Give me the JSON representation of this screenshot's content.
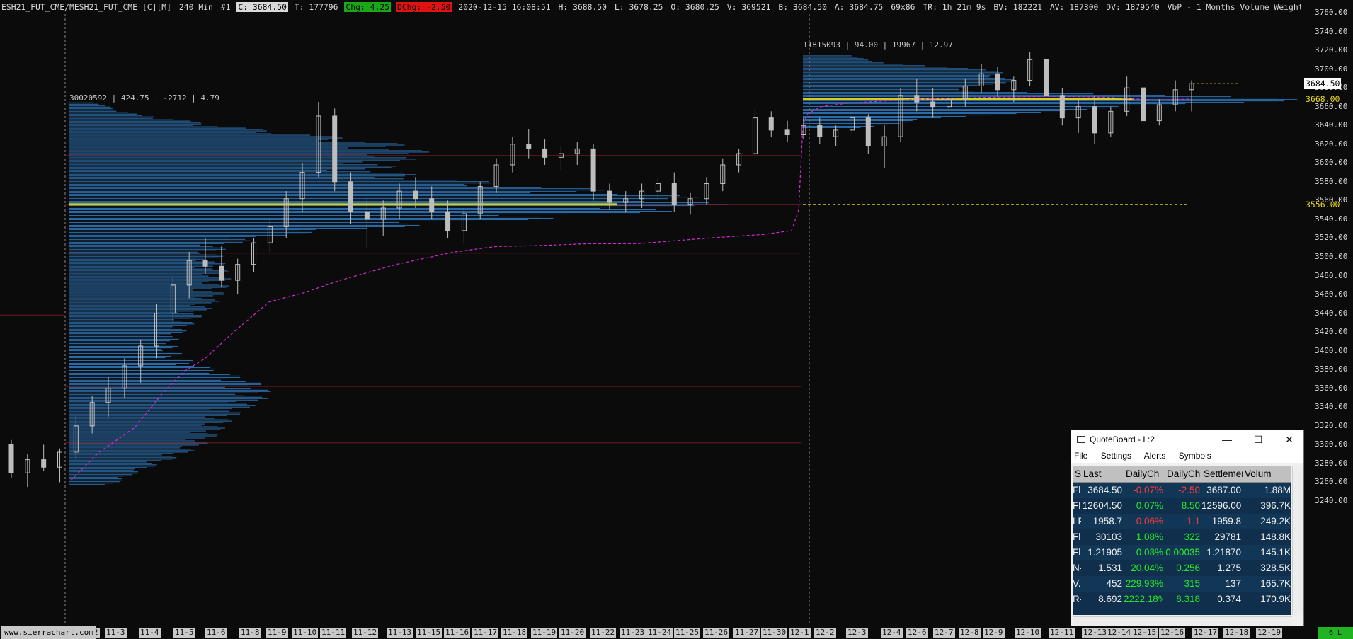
{
  "header": {
    "symbol": "ESH21_FUT_CME/MESH21_FUT_CME [C][M]",
    "timeframe": "240 Min",
    "chart_no": "#1",
    "last": "C: 3684.50",
    "trades": "T: 177796",
    "change": "Chg: 4.25",
    "dchange": "DChg: -2.50",
    "datetime": "2020-12-15 16:08:51",
    "high": "H: 3688.50",
    "low": "L: 3678.25",
    "open": "O: 3680.25",
    "volume": "V: 369521",
    "bid": "B: 3684.50",
    "ask": "A: 3684.75",
    "bid_ask_size": "69x86",
    "time_remaining": "TR: 1h 21m 9s",
    "bid_volume": "BV: 182221",
    "ask_volume": "AV: 187300",
    "daily_volume": "DV: 1879540",
    "study": "VbP - 1 Months  Volume Weighted"
  },
  "profiles": {
    "left_stats": "30020592 | 424.75 | -2712 | 4.79",
    "right_stats": "11815093 | 94.00 | 19967 | 12.97"
  },
  "price_axis": {
    "ticks": [
      "3760.00",
      "3740.00",
      "3720.00",
      "3700.00",
      "3680.00",
      "3660.00",
      "3640.00",
      "3620.00",
      "3600.00",
      "3580.00",
      "3560.00",
      "3540.00",
      "3520.00",
      "3500.00",
      "3480.00",
      "3460.00",
      "3440.00",
      "3420.00",
      "3400.00",
      "3380.00",
      "3360.00",
      "3340.00",
      "3320.00",
      "3300.00",
      "3280.00",
      "3260.00",
      "3240.00"
    ],
    "last_price_label": "3684.50",
    "poc_label_top": "3668.00",
    "poc_label_bottom": "3556.00"
  },
  "time_axis": {
    "ticks": [
      "11-2",
      "11-3",
      "11-4",
      "11-5",
      "11-6",
      "11-8",
      "11-9",
      "11-10",
      "11-11",
      "11-12",
      "11-13",
      "11-15",
      "11-16",
      "11-17",
      "11-18",
      "11-19",
      "11-20",
      "11-22",
      "11-23",
      "11-24",
      "11-25",
      "11-26",
      "11-27",
      "11-30",
      "12-1",
      "12-2",
      "12-3",
      "12-4",
      "12-6",
      "12-7",
      "12-8",
      "12-9",
      "12-10",
      "12-11",
      "12-13",
      "12-14",
      "12-15",
      "12-16",
      "12-17",
      "12-18",
      "12-19"
    ]
  },
  "watermark": "www.sierrachart.com",
  "status_corner": "6 L",
  "chart_data": {
    "type": "candlestick",
    "y_range": [
      3230,
      3765
    ],
    "x_range": [
      "11-2",
      "12-19"
    ],
    "volume_profile_poc": [
      3556.0,
      3668.0
    ],
    "last": 3684.5,
    "candles": [
      [
        3300,
        3305,
        3265,
        3270
      ],
      [
        3270,
        3290,
        3255,
        3284
      ],
      [
        3284,
        3300,
        3272,
        3276
      ],
      [
        3276,
        3296,
        3260,
        3292
      ],
      [
        3292,
        3330,
        3285,
        3320
      ],
      [
        3320,
        3352,
        3312,
        3345
      ],
      [
        3345,
        3372,
        3330,
        3360
      ],
      [
        3360,
        3392,
        3350,
        3384
      ],
      [
        3384,
        3412,
        3366,
        3405
      ],
      [
        3405,
        3450,
        3392,
        3440
      ],
      [
        3440,
        3478,
        3430,
        3470
      ],
      [
        3470,
        3505,
        3456,
        3496
      ],
      [
        3496,
        3520,
        3482,
        3490
      ],
      [
        3490,
        3512,
        3468,
        3475
      ],
      [
        3475,
        3498,
        3460,
        3492
      ],
      [
        3492,
        3520,
        3484,
        3515
      ],
      [
        3515,
        3540,
        3505,
        3532
      ],
      [
        3532,
        3570,
        3520,
        3562
      ],
      [
        3562,
        3600,
        3548,
        3590
      ],
      [
        3590,
        3665,
        3585,
        3650
      ],
      [
        3650,
        3658,
        3570,
        3580
      ],
      [
        3580,
        3590,
        3535,
        3548
      ],
      [
        3548,
        3562,
        3510,
        3540
      ],
      [
        3540,
        3560,
        3522,
        3552
      ],
      [
        3552,
        3578,
        3540,
        3570
      ],
      [
        3570,
        3585,
        3552,
        3562
      ],
      [
        3562,
        3575,
        3540,
        3548
      ],
      [
        3548,
        3560,
        3520,
        3528
      ],
      [
        3528,
        3552,
        3515,
        3546
      ],
      [
        3546,
        3580,
        3540,
        3575
      ],
      [
        3575,
        3605,
        3568,
        3598
      ],
      [
        3598,
        3628,
        3590,
        3620
      ],
      [
        3620,
        3636,
        3605,
        3615
      ],
      [
        3615,
        3625,
        3598,
        3606
      ],
      [
        3606,
        3618,
        3592,
        3610
      ],
      [
        3610,
        3622,
        3598,
        3615
      ],
      [
        3615,
        3620,
        3560,
        3570
      ],
      [
        3570,
        3578,
        3550,
        3558
      ],
      [
        3558,
        3570,
        3548,
        3562
      ],
      [
        3562,
        3578,
        3552,
        3570
      ],
      [
        3570,
        3585,
        3560,
        3578
      ],
      [
        3578,
        3590,
        3548,
        3556
      ],
      [
        3556,
        3568,
        3545,
        3562
      ],
      [
        3562,
        3585,
        3555,
        3578
      ],
      [
        3578,
        3605,
        3570,
        3598
      ],
      [
        3598,
        3615,
        3590,
        3610
      ],
      [
        3610,
        3658,
        3606,
        3648
      ],
      [
        3648,
        3655,
        3628,
        3635
      ],
      [
        3635,
        3645,
        3622,
        3630
      ],
      [
        3630,
        3648,
        3625,
        3640
      ],
      [
        3640,
        3648,
        3620,
        3628
      ],
      [
        3628,
        3640,
        3618,
        3635
      ],
      [
        3635,
        3655,
        3630,
        3648
      ],
      [
        3648,
        3652,
        3610,
        3618
      ],
      [
        3618,
        3640,
        3595,
        3628
      ],
      [
        3628,
        3680,
        3622,
        3672
      ],
      [
        3672,
        3690,
        3655,
        3665
      ],
      [
        3665,
        3680,
        3648,
        3660
      ],
      [
        3660,
        3675,
        3650,
        3668
      ],
      [
        3668,
        3690,
        3660,
        3682
      ],
      [
        3682,
        3705,
        3675,
        3695
      ],
      [
        3695,
        3702,
        3670,
        3678
      ],
      [
        3678,
        3692,
        3665,
        3688
      ],
      [
        3688,
        3718,
        3682,
        3710
      ],
      [
        3710,
        3715,
        3668,
        3672
      ],
      [
        3672,
        3680,
        3640,
        3648
      ],
      [
        3648,
        3668,
        3632,
        3660
      ],
      [
        3660,
        3672,
        3620,
        3632
      ],
      [
        3632,
        3660,
        3628,
        3655
      ],
      [
        3655,
        3692,
        3650,
        3680
      ],
      [
        3680,
        3688,
        3638,
        3645
      ],
      [
        3645,
        3668,
        3640,
        3662
      ],
      [
        3662,
        3688,
        3655,
        3678
      ],
      [
        3678,
        3688,
        3655,
        3684.5
      ]
    ]
  }
}
